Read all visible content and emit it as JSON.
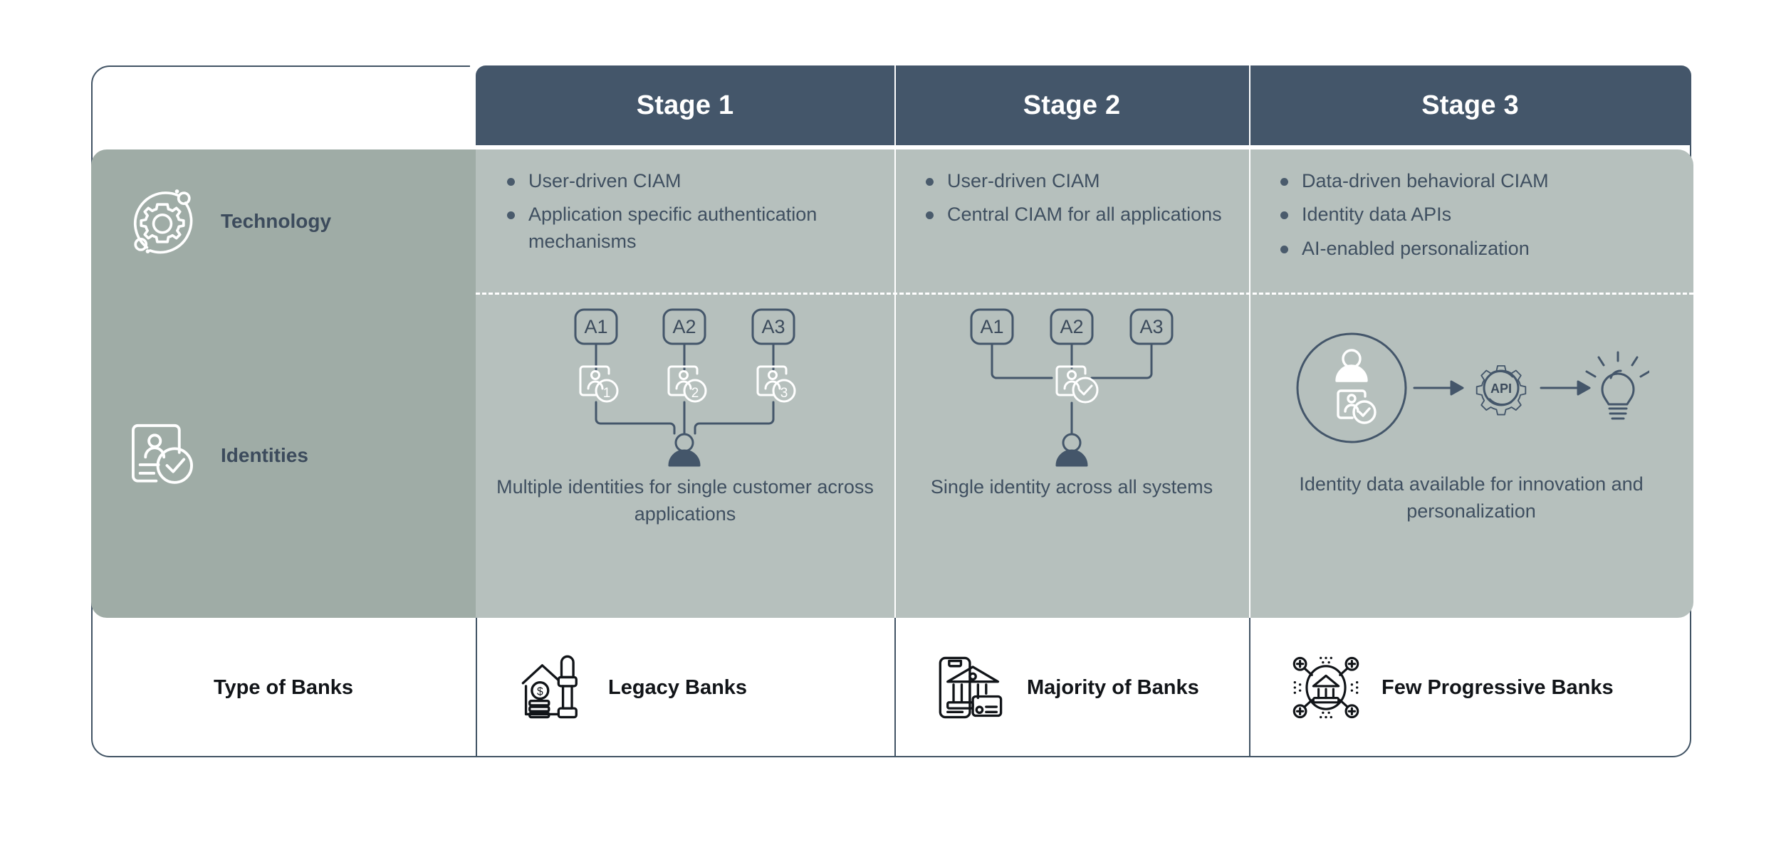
{
  "colors": {
    "header_bg": "#44566a",
    "panel_label_bg": "#9faca6",
    "panel_stage_bg": "#b6c0bd",
    "text_dark": "#3f4f60",
    "border": "#415364",
    "icon_white": "#ffffff",
    "page_bg": "#ffffff"
  },
  "header": {
    "stages": [
      {
        "label": "Stage 1"
      },
      {
        "label": "Stage 2"
      },
      {
        "label": "Stage 3"
      }
    ]
  },
  "rows": {
    "technology": {
      "label": "Technology",
      "icon": "gear-orbit-icon",
      "cells": [
        {
          "bullets": [
            "User-driven CIAM",
            "Application specific authentication mechanisms"
          ]
        },
        {
          "bullets": [
            "User-driven CIAM",
            "Central CIAM for all applications"
          ]
        },
        {
          "bullets": [
            "Data-driven behavioral CIAM",
            "Identity data APIs",
            "AI-enabled personalization"
          ]
        }
      ]
    },
    "identities": {
      "label": "Identities",
      "icon": "id-card-check-icon",
      "cells": [
        {
          "diagram": "multiple-identities-diagram",
          "app_nodes": [
            "A1",
            "A2",
            "A3"
          ],
          "identity_badges": [
            "1",
            "2",
            "3"
          ],
          "caption": "Multiple identities for single customer across applications"
        },
        {
          "diagram": "single-identity-diagram",
          "app_nodes": [
            "A1",
            "A2",
            "A3"
          ],
          "identity_badges": [],
          "caption": "Single identity across all systems"
        },
        {
          "diagram": "identity-data-flow-diagram",
          "flow_nodes": [
            "user-identity-circle-icon",
            "api-gear-icon",
            "lightbulb-icon"
          ],
          "api_label": "API",
          "caption": "Identity data available for innovation and personalization"
        }
      ]
    },
    "type_of_banks": {
      "label": "Type of Banks",
      "cells": [
        {
          "icon": "house-money-gavel-icon",
          "label": "Legacy Banks"
        },
        {
          "icon": "mobile-bank-card-icon",
          "label": "Majority of Banks"
        },
        {
          "icon": "connected-bank-network-icon",
          "label": "Few Progressive Banks"
        }
      ]
    }
  }
}
